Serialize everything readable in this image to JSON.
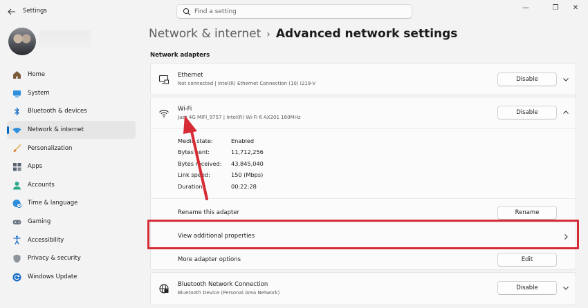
{
  "window": {
    "title": "Settings",
    "minimize": "—",
    "maximize": "❐",
    "close": "✕"
  },
  "search": {
    "placeholder": "Find a setting",
    "value": ""
  },
  "sidebar": {
    "items": [
      {
        "label": "Home",
        "icon": "home-icon",
        "active": false
      },
      {
        "label": "System",
        "icon": "system-icon",
        "active": false
      },
      {
        "label": "Bluetooth & devices",
        "icon": "bluetooth-icon",
        "active": false
      },
      {
        "label": "Network & internet",
        "icon": "wifi-icon",
        "active": true
      },
      {
        "label": "Personalization",
        "icon": "brush-icon",
        "active": false
      },
      {
        "label": "Apps",
        "icon": "apps-icon",
        "active": false
      },
      {
        "label": "Accounts",
        "icon": "account-icon",
        "active": false
      },
      {
        "label": "Time & language",
        "icon": "globe-clock-icon",
        "active": false
      },
      {
        "label": "Gaming",
        "icon": "gamepad-icon",
        "active": false
      },
      {
        "label": "Accessibility",
        "icon": "accessibility-icon",
        "active": false
      },
      {
        "label": "Privacy & security",
        "icon": "shield-icon",
        "active": false
      },
      {
        "label": "Windows Update",
        "icon": "update-icon",
        "active": false
      }
    ]
  },
  "header": {
    "parent": "Network & internet",
    "separator": "›",
    "current": "Advanced network settings"
  },
  "section_title": "Network adapters",
  "adapters": {
    "ethernet": {
      "name": "Ethernet",
      "description": "Not connected | Intel(R) Ethernet Connection (10) I219-V",
      "button": "Disable"
    },
    "wifi": {
      "name": "Wi-Fi",
      "description": "Jazz 4G MIFI_9757 | Intel(R) Wi-Fi 6 AX201 160MHz",
      "button": "Disable",
      "stats": [
        {
          "label": "Media state:",
          "value": "Enabled"
        },
        {
          "label": "Bytes sent:",
          "value": "11,712,256"
        },
        {
          "label": "Bytes received:",
          "value": "43,845,040"
        },
        {
          "label": "Link speed:",
          "value": "150 (Mbps)"
        },
        {
          "label": "Duration:",
          "value": "00:22:28"
        }
      ],
      "rename_label": "Rename this adapter",
      "rename_button": "Rename",
      "view_properties": "View additional properties",
      "more_options": "More adapter options",
      "edit_button": "Edit"
    },
    "bluetooth": {
      "name": "Bluetooth Network Connection",
      "description": "Bluetooth Device (Personal Area Network)",
      "button": "Disable"
    }
  },
  "colors": {
    "accent": "#0067c0",
    "highlight": "#d62b35"
  }
}
